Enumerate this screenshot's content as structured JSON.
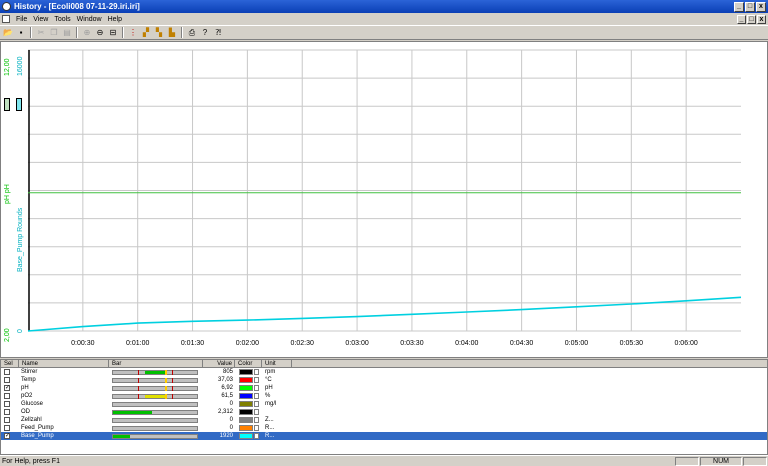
{
  "window": {
    "title": "History - [Ecoli008 07-11-29.iri.iri]",
    "min_glyph": "_",
    "max_glyph": "□",
    "close_glyph": "x"
  },
  "menu": [
    "File",
    "View",
    "Tools",
    "Window",
    "Help"
  ],
  "menu_accel": [
    "F",
    "V",
    "T",
    "W",
    "H"
  ],
  "toolbar": {
    "icons": [
      "open-icon",
      "save-icon",
      "cut-icon",
      "copy-icon",
      "paste-icon",
      "zoom-in-icon",
      "zoom-out-icon",
      "fit-icon",
      "marker-icon",
      "export-icon",
      "import-icon",
      "settings-icon",
      "print-icon",
      "help-icon",
      "context-help-icon"
    ]
  },
  "chart_data": {
    "type": "line",
    "x_ticks": [
      "0:00:30",
      "0:01:00",
      "0:01:30",
      "0:02:00",
      "0:02:30",
      "0:03:00",
      "0:03:30",
      "0:04:00",
      "0:04:30",
      "0:05:00",
      "0:05:30",
      "0:06:00"
    ],
    "y_axes": [
      {
        "label": "pH pH",
        "top": "12,00",
        "bottom": "2,00",
        "color": "#00c000"
      },
      {
        "label": "Base_Pump Rounds",
        "top": "16000",
        "bottom": "0",
        "color": "#00d0d0"
      }
    ],
    "series": [
      {
        "name": "pH",
        "color": "#40c040",
        "x": [
          0,
          390
        ],
        "y": [
          6.92,
          6.92
        ]
      },
      {
        "name": "Base_Pump",
        "color": "#00d0e0",
        "x": [
          0,
          30,
          60,
          90,
          120,
          150,
          180,
          210,
          240,
          270,
          300,
          330,
          360,
          390
        ],
        "y": [
          0,
          250,
          450,
          550,
          620,
          720,
          820,
          950,
          1080,
          1220,
          1380,
          1540,
          1720,
          1920
        ]
      }
    ],
    "grid": true
  },
  "table": {
    "headers": [
      "Sel",
      "Name",
      "Bar",
      "Value",
      "Color",
      "Unit"
    ],
    "rows": [
      {
        "checked": false,
        "name": "Stirrer",
        "value": "805",
        "unit": "rpm",
        "color": "#000000",
        "fill": 0.0,
        "selected": false
      },
      {
        "checked": false,
        "name": "Temp",
        "value": "37,03",
        "unit": "°C",
        "color": "#ff0000",
        "fill": 0.0,
        "selected": false
      },
      {
        "checked": true,
        "name": "pH",
        "value": "6,92",
        "unit": "pH",
        "color": "#00ff00",
        "fill": 0.0,
        "selected": false
      },
      {
        "checked": false,
        "name": "pO2",
        "value": "61,5",
        "unit": "%",
        "color": "#0000ff",
        "fill": 0.0,
        "selected": false
      },
      {
        "checked": false,
        "name": "Glucose",
        "value": "0",
        "unit": "mg/l",
        "color": "#808000",
        "fill": 0.0,
        "selected": false
      },
      {
        "checked": false,
        "name": "OD",
        "value": "2,312",
        "unit": "",
        "color": "#000000",
        "fill": 0.46,
        "selected": false
      },
      {
        "checked": false,
        "name": "Zellzahl",
        "value": "0",
        "unit": "Z...",
        "color": "#808080",
        "fill": 0.0,
        "selected": false
      },
      {
        "checked": false,
        "name": "Feed_Pump",
        "value": "0",
        "unit": "R...",
        "color": "#ff8000",
        "fill": 0.0,
        "selected": false
      },
      {
        "checked": true,
        "name": "Base_Pump",
        "value": "1920",
        "unit": "R...",
        "color": "#00ffff",
        "fill": 0.2,
        "selected": true
      }
    ]
  },
  "status": {
    "message": "For Help, press F1",
    "num": "NUM"
  }
}
